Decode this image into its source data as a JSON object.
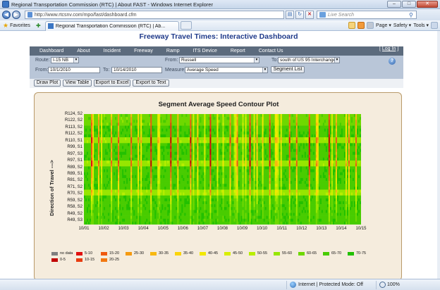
{
  "browser": {
    "title": "Regional Transportation Commission (RTC) | About FAST - Windows Internet Explorer",
    "url": "http://www.rtcsnv.com/mpo/fast/dashboard.cfm",
    "search_placeholder": "Live Search",
    "favorites_label": "Favorites",
    "tab_label": "Regional Transportation Commission (RTC) | Ab...",
    "commands": {
      "page": "Page",
      "safety": "Safety",
      "tools": "Tools"
    },
    "status": {
      "zone": "Internet | Protected Mode: Off",
      "zoom": "100%"
    }
  },
  "page": {
    "title": "Freeway Travel Times: Interactive Dashboard",
    "login": "Log In",
    "nav": [
      "Dashboard",
      "About",
      "Incident",
      "Freeway",
      "Ramp",
      "ITS Device",
      "Report",
      "Contact Us"
    ],
    "controls": {
      "route_label": "Route:",
      "route_value": "I-15 NB",
      "from_loc_label": "From:",
      "from_loc_value": "Russell",
      "to_loc_label": "To:",
      "to_loc_value": "south of US 95 Interchange",
      "from_date_label": "From:",
      "from_date_value": "10/1/2010",
      "to_date_label": "To:",
      "to_date_value": "10/14/2010",
      "measure_label": "Measure:",
      "measure_value": "Average Speed",
      "segment_button": "Segment List"
    },
    "actions": [
      "Draw Plot",
      "View Table",
      "Export to Excel",
      "Export to Text"
    ]
  },
  "chart_data": {
    "type": "heatmap",
    "title": "Segment Average Speed Contour Plot",
    "ylabel": "Direction of Travel --->",
    "xlabel": "",
    "x_ticks": [
      "10/01",
      "10/02",
      "10/03",
      "10/04",
      "10/05",
      "10/06",
      "10/07",
      "10/08",
      "10/09",
      "10/10",
      "10/11",
      "10/12",
      "10/13",
      "10/14",
      "10/15"
    ],
    "y_ticks": [
      "R124, S2",
      "R122, S2",
      "R113, S2",
      "R112, S2",
      "R110, S1",
      "R99, S1",
      "R97, S3",
      "R97, S1",
      "R89, S2",
      "R89, S1",
      "R81, S2",
      "R71, S2",
      "R70, S2",
      "R59, S2",
      "R58, S2",
      "R49, S2",
      "R49, S3"
    ],
    "legend": [
      {
        "label": "no data",
        "color": "#808080"
      },
      {
        "label": "0-5",
        "color": "#c00000"
      },
      {
        "label": "5-10",
        "color": "#e01010"
      },
      {
        "label": "10-15",
        "color": "#e83c10"
      },
      {
        "label": "15-20",
        "color": "#ef5a10"
      },
      {
        "label": "20-25",
        "color": "#f27810"
      },
      {
        "label": "25-30",
        "color": "#f59a10"
      },
      {
        "label": "30-35",
        "color": "#f8b810"
      },
      {
        "label": "35-40",
        "color": "#fbd40a"
      },
      {
        "label": "40-45",
        "color": "#f2e800"
      },
      {
        "label": "45-50",
        "color": "#d8ee00"
      },
      {
        "label": "50-55",
        "color": "#b8ee00"
      },
      {
        "label": "55-60",
        "color": "#96e600"
      },
      {
        "label": "60-65",
        "color": "#6ed800"
      },
      {
        "label": "65-70",
        "color": "#48cc00"
      },
      {
        "label": "70-75",
        "color": "#22c000"
      }
    ]
  }
}
